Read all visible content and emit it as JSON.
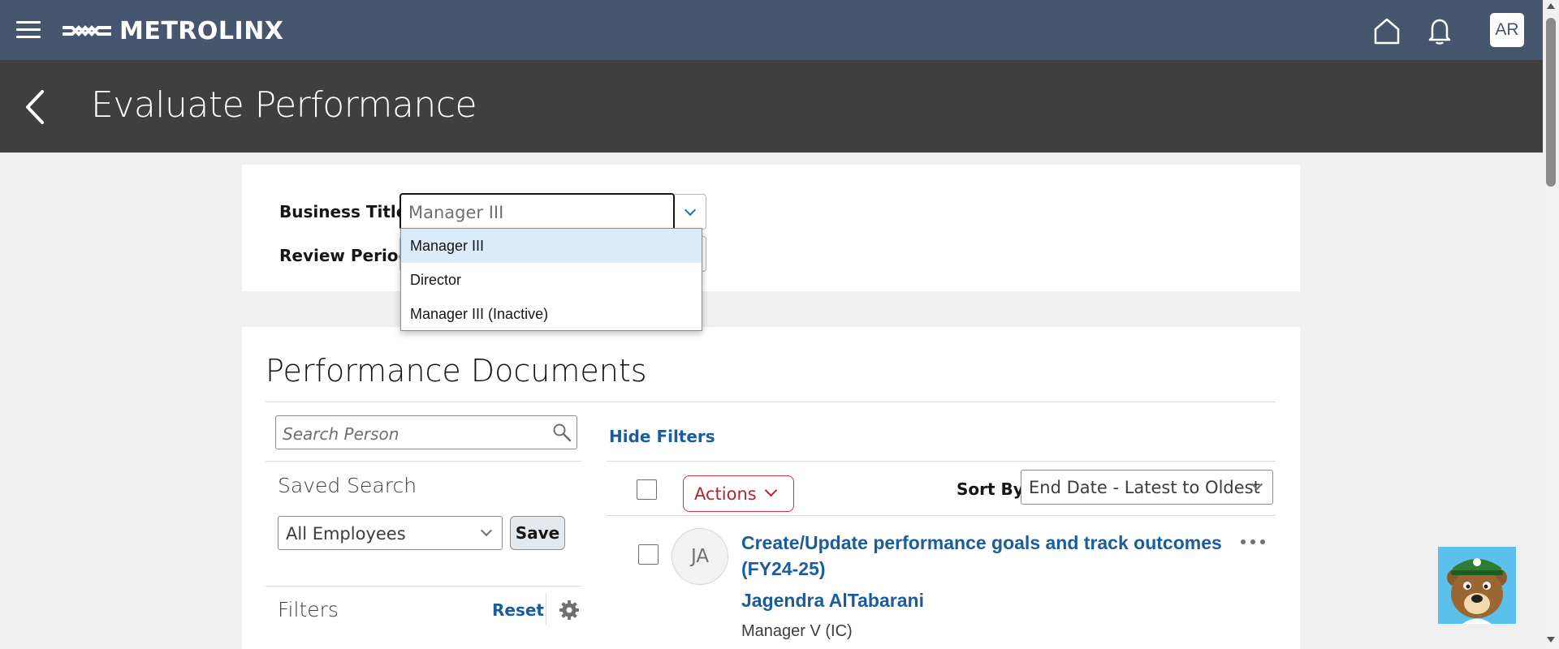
{
  "app": {
    "brand": "METROLINX",
    "avatar_initials": "AR",
    "brand_color": "#46566f"
  },
  "header": {
    "title": "Evaluate Performance"
  },
  "icons": [
    "hamburger-menu-icon",
    "home-icon",
    "bell-icon",
    "back-icon",
    "search-icon",
    "gear-icon",
    "chevron-down-icon",
    "more-options-icon"
  ],
  "filter_form": {
    "business_title_label": "Business Title",
    "business_title_value": "Manager III",
    "review_period_label": "Review Period",
    "dropdown_options": [
      "Manager III",
      "Director",
      "Manager III (Inactive)"
    ],
    "selected_option": "Manager III"
  },
  "documents": {
    "title": "Performance Documents",
    "search_placeholder": "Search Person",
    "hide_filters_label": "Hide Filters",
    "saved_search_label": "Saved Search",
    "saved_search_value": "All Employees",
    "save_label": "Save",
    "filters_label": "Filters",
    "reset_label": "Reset",
    "actions_label": "Actions",
    "sort_by_label": "Sort By",
    "sort_by_value": "End Date - Latest to Oldest",
    "rows": [
      {
        "initials": "JA",
        "title": "Create/Update performance goals and track outcomes (FY24-25)",
        "name": "Jagendra AlTabarani",
        "role": "Manager V (IC)"
      }
    ]
  }
}
